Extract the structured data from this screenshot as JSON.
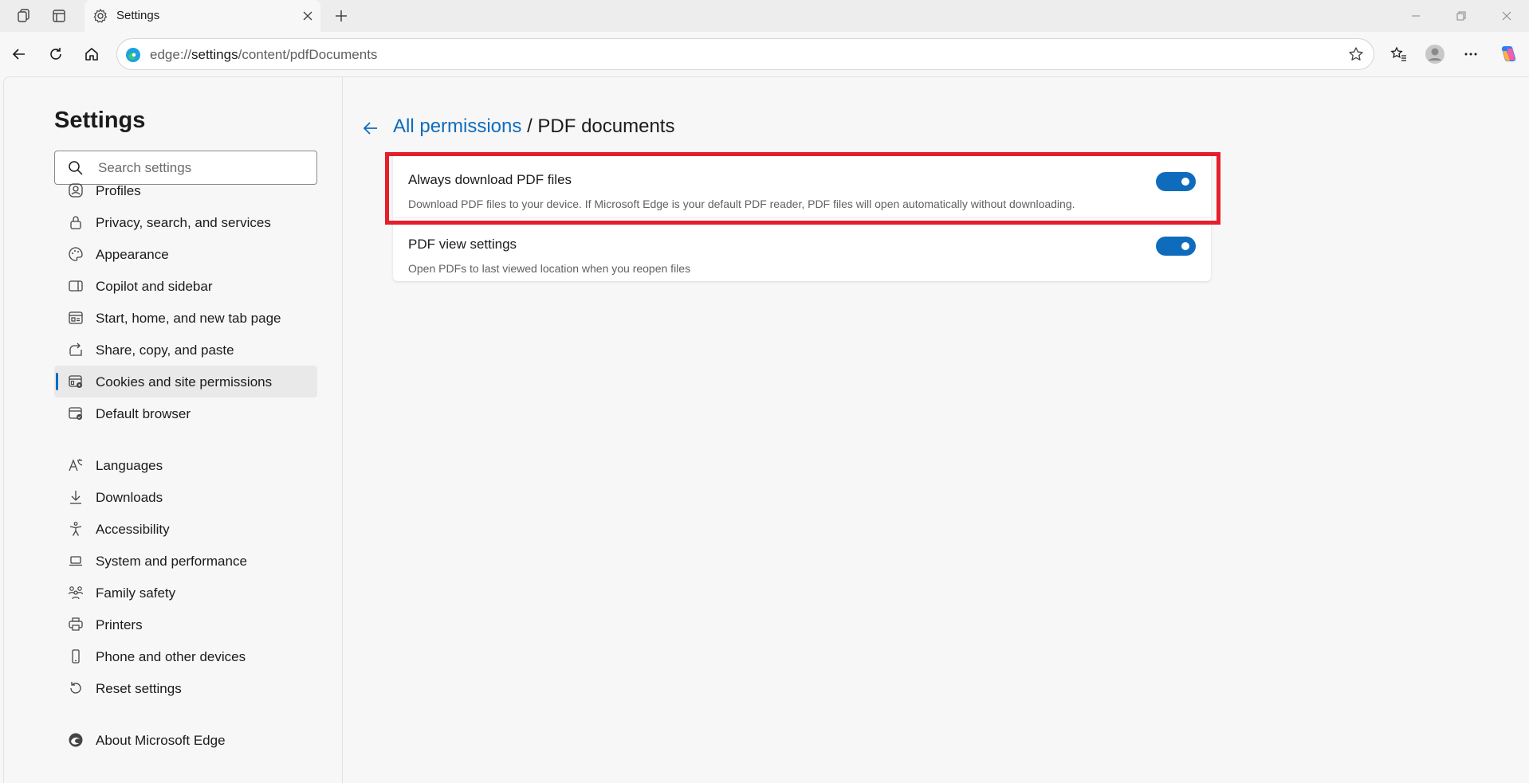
{
  "browser": {
    "tab": {
      "title": "Settings"
    },
    "address_bar": {
      "prefix": "edge://",
      "host": "settings",
      "path": "/content/pdfDocuments"
    }
  },
  "sidebar": {
    "title": "Settings",
    "search_placeholder": "Search settings",
    "items": [
      {
        "label": "Profiles",
        "icon": "profile-icon"
      },
      {
        "label": "Privacy, search, and services",
        "icon": "lock-icon"
      },
      {
        "label": "Appearance",
        "icon": "palette-icon"
      },
      {
        "label": "Copilot and sidebar",
        "icon": "sidebar-icon"
      },
      {
        "label": "Start, home, and new tab page",
        "icon": "home-page-icon"
      },
      {
        "label": "Share, copy, and paste",
        "icon": "share-icon"
      },
      {
        "label": "Cookies and site permissions",
        "icon": "site-permissions-icon",
        "active": true
      },
      {
        "label": "Default browser",
        "icon": "default-browser-icon"
      },
      {
        "label": "Languages",
        "icon": "languages-icon"
      },
      {
        "label": "Downloads",
        "icon": "download-icon"
      },
      {
        "label": "Accessibility",
        "icon": "accessibility-icon"
      },
      {
        "label": "System and performance",
        "icon": "laptop-icon"
      },
      {
        "label": "Family safety",
        "icon": "family-icon"
      },
      {
        "label": "Printers",
        "icon": "printer-icon"
      },
      {
        "label": "Phone and other devices",
        "icon": "phone-icon"
      },
      {
        "label": "Reset settings",
        "icon": "reset-icon"
      },
      {
        "label": "About Microsoft Edge",
        "icon": "edge-logo-icon"
      }
    ]
  },
  "content": {
    "breadcrumb": {
      "parent": "All permissions",
      "separator": "/",
      "current": "PDF documents"
    },
    "settings": [
      {
        "title": "Always download PDF files",
        "description": "Download PDF files to your device. If Microsoft Edge is your default PDF reader, PDF files will open automatically without downloading.",
        "enabled": true
      },
      {
        "title": "PDF view settings",
        "description": "Open PDFs to last viewed location when you reopen files",
        "enabled": true
      }
    ]
  },
  "colors": {
    "accent": "#0f6cbd",
    "highlight": "#e51e2b"
  }
}
